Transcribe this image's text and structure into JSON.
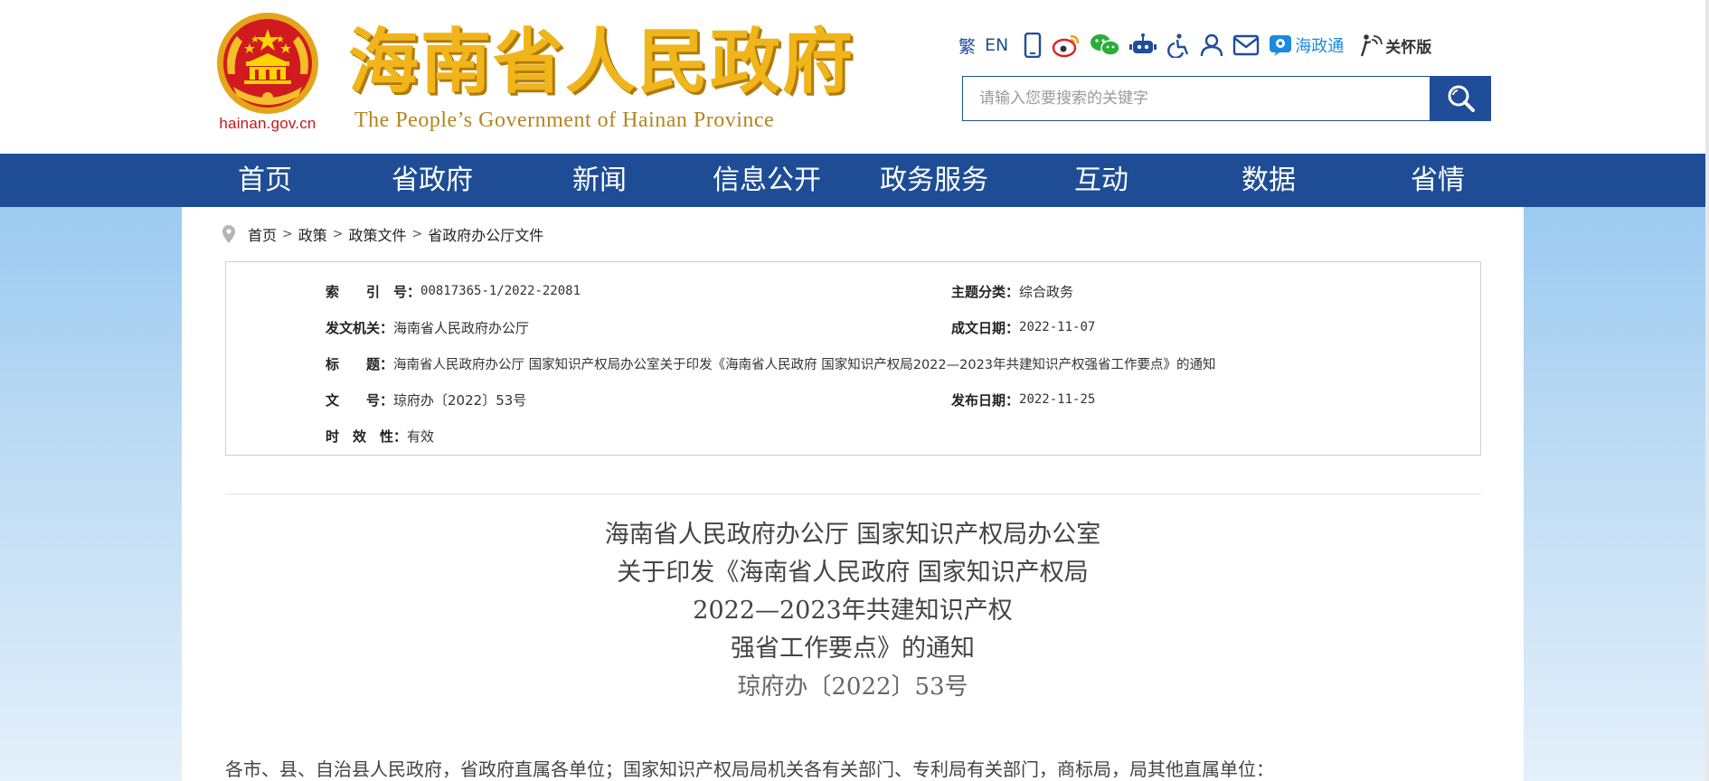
{
  "header": {
    "site_domain": "hainan.gov.cn",
    "brand_cn": "海南省人民政府",
    "brand_en": "The People’s Government  of Hainan Province",
    "tools": {
      "traditional": "繁",
      "english": "EN",
      "haizhengtong": "海政通",
      "elderly_mode": "关怀版"
    },
    "search": {
      "placeholder": "请输入您要搜索的关键字"
    }
  },
  "nav": {
    "items": [
      "首页",
      "省政府",
      "新闻",
      "信息公开",
      "政务服务",
      "互动",
      "数据",
      "省情"
    ]
  },
  "breadcrumb": {
    "items": [
      "首页",
      "政策",
      "政策文件",
      "省政府办公厅文件"
    ],
    "separator": ">"
  },
  "meta": {
    "index_label": "索　　引　号：",
    "index_value": "00817365-1/2022-22081",
    "topic_label": "主题分类：",
    "topic_value": "综合政务",
    "issuer_label": "发文机关：",
    "issuer_value": "海南省人民政府办公厅",
    "created_label": "成文日期：",
    "created_value": "2022-11-07",
    "title_label": "标　　题：",
    "title_value": "海南省人民政府办公厅 国家知识产权局办公室关于印发《海南省人民政府 国家知识产权局2022—2023年共建知识产权强省工作要点》的通知",
    "docno_label": "文　　号：",
    "docno_value": "琼府办〔2022〕53号",
    "published_label": "发布日期：",
    "published_value": "2022-11-25",
    "validity_label": "时　效　性：",
    "validity_value": "有效"
  },
  "document": {
    "title_lines": [
      "海南省人民政府办公厅 国家知识产权局办公室",
      "关于印发《海南省人民政府 国家知识产权局",
      "2022—2023年共建知识产权",
      "强省工作要点》的通知"
    ],
    "number": "琼府办〔2022〕53号",
    "recipients": "各市、县、自治县人民政府，省政府直属各单位；国家知识产权局局机关各有关部门、专利局有关部门，商标局，局其他直属单位："
  },
  "colors": {
    "nav_bg": "#1e4d95",
    "brand_gold": "#f0b51b",
    "emblem_red": "#c8161d",
    "link_blue": "#1b8be0"
  }
}
